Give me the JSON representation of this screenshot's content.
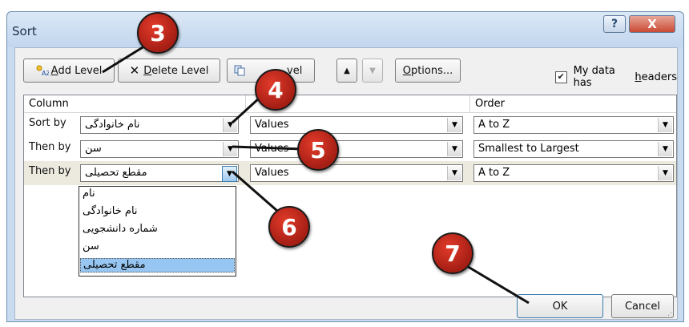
{
  "window": {
    "title": "Sort",
    "help_glyph": "?",
    "close_glyph": "X"
  },
  "toolbar": {
    "add_level": {
      "prefix": "",
      "underline": "A",
      "rest": "dd Level",
      "icon": "add-level-icon"
    },
    "delete_level": {
      "underline": "D",
      "rest": "elete Level",
      "icon": "delete-x-icon"
    },
    "copy_level": {
      "label_visible": "vel",
      "icon": "copy-level-icon"
    },
    "move_up_glyph": "▲",
    "move_down_glyph": "▼",
    "options": {
      "underline": "O",
      "rest": "ptions..."
    },
    "headers_checkbox": {
      "checked": true,
      "label_before": "My data has ",
      "underline": "h",
      "label_after": "eaders"
    }
  },
  "grid": {
    "headers": {
      "column": "Column",
      "order": "Order"
    },
    "rows": [
      {
        "label": "Sort by",
        "column": "نام خانوادگی",
        "sort_on": "Values",
        "order": "A to Z"
      },
      {
        "label": "Then by",
        "column": "سن",
        "sort_on": "Values",
        "order": "Smallest to Largest"
      },
      {
        "label": "Then by",
        "column": "مقطع تحصیلی",
        "sort_on": "Values",
        "order": "A to Z"
      }
    ]
  },
  "dropdown": {
    "options": [
      "نام",
      "نام خانوادگی",
      "شماره دانشجویی",
      "سن",
      "مقطع تحصیلی"
    ],
    "selected_index": 4
  },
  "footer": {
    "ok": "OK",
    "cancel": "Cancel"
  },
  "callouts": [
    "3",
    "4",
    "5",
    "6",
    "7"
  ],
  "colors": {
    "badge": "#c8281b",
    "selection": "#97c6f2",
    "title_bar": "#c9dbef"
  }
}
